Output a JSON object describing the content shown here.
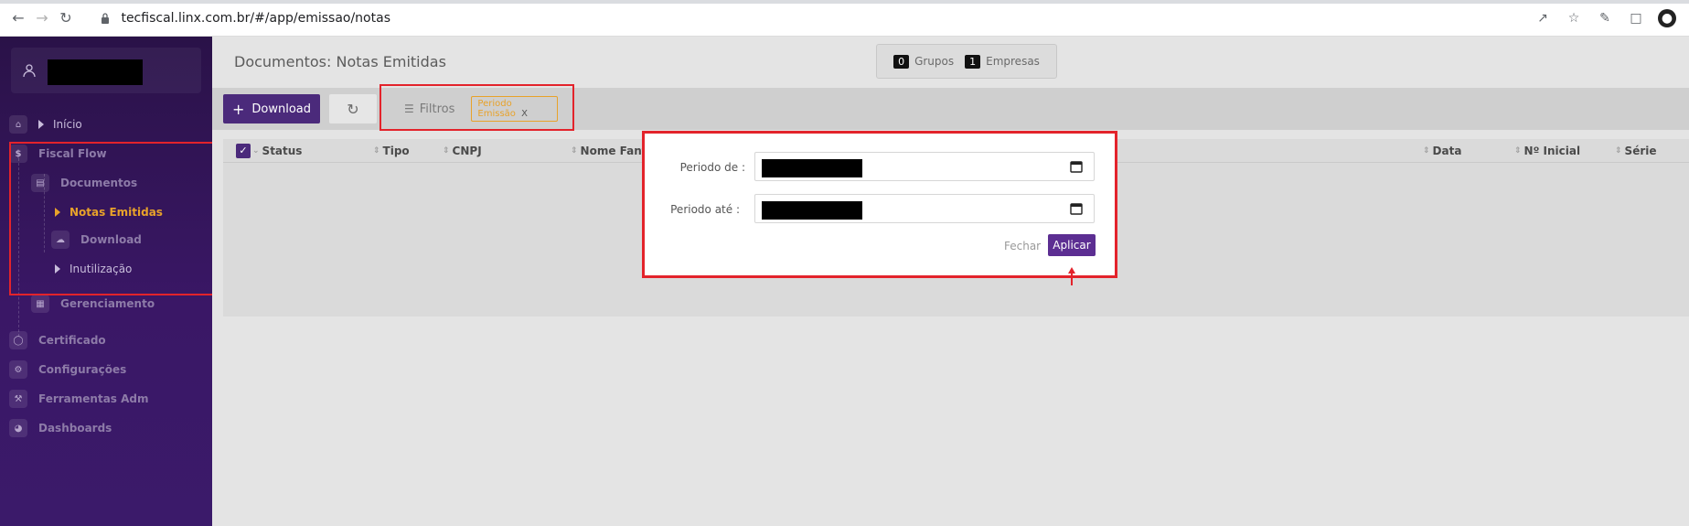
{
  "browser": {
    "url": "tecfiscal.linx.com.br/#/app/emissao/notas"
  },
  "sidebar": {
    "items": [
      {
        "label": "Início"
      },
      {
        "label": "Fiscal Flow"
      },
      {
        "label": "Documentos"
      },
      {
        "label": "Notas Emitidas"
      },
      {
        "label": "Download"
      },
      {
        "label": "Inutilização"
      },
      {
        "label": "Gerenciamento"
      },
      {
        "label": "Certificado"
      },
      {
        "label": "Configurações"
      },
      {
        "label": "Ferramentas Adm"
      },
      {
        "label": "Dashboards"
      }
    ]
  },
  "header": {
    "title": "Documentos: Notas Emitidas",
    "grupos_count": "0",
    "grupos_label": "Grupos",
    "empresas_count": "1",
    "empresas_label": "Empresas"
  },
  "toolbar": {
    "download_label": "Download",
    "filtros_label": "Filtros",
    "filter_chip": "Periodo Emissão",
    "chip_close": "X"
  },
  "table": {
    "columns": [
      "Status",
      "Tipo",
      "CNPJ",
      "Nome Fanta",
      "Data",
      "Nº Inicial",
      "Série"
    ]
  },
  "modal": {
    "label_de": "Periodo de :",
    "label_ate": "Periodo até :",
    "fechar": "Fechar",
    "aplicar": "Aplicar"
  },
  "colors": {
    "accent": "#4b2a7b",
    "highlight": "#e8a22a",
    "annotation": "#e3232b"
  }
}
